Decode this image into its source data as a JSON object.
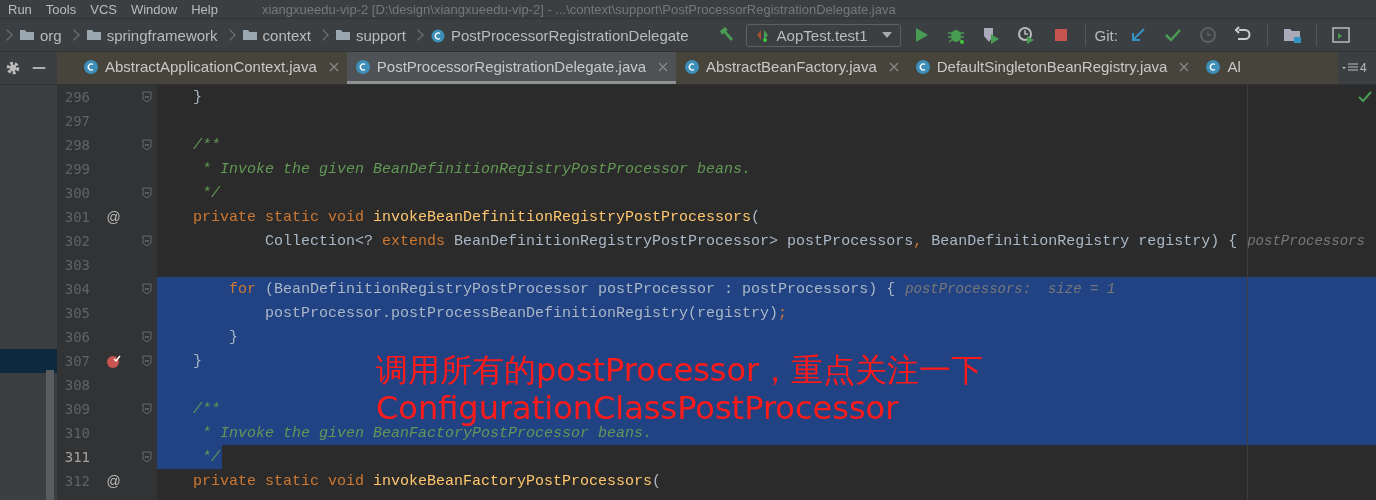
{
  "menu_bar": {
    "items": [
      "Run",
      "Tools",
      "VCS",
      "Window",
      "Help"
    ],
    "title": "xiangxueedu-vip-2 [D:\\design\\xiangxueedu-vip-2] - ...\\context\\support\\PostProcessorRegistrationDelegate.java"
  },
  "breadcrumbs": [
    {
      "kind": "folder",
      "label": "org"
    },
    {
      "kind": "folder",
      "label": "springframework"
    },
    {
      "kind": "folder",
      "label": "context"
    },
    {
      "kind": "folder",
      "label": "support"
    },
    {
      "kind": "class",
      "label": "PostProcessorRegistrationDelegate"
    }
  ],
  "toolbar": {
    "run_config": "AopTest.test1",
    "git_label": "Git:"
  },
  "tabs": [
    {
      "label": "AbstractApplicationContext.java",
      "selected": false,
      "closable": true
    },
    {
      "label": "PostProcessorRegistrationDelegate.java",
      "selected": true,
      "closable": true
    },
    {
      "label": "AbstractBeanFactory.java",
      "selected": false,
      "closable": true
    },
    {
      "label": "DefaultSingletonBeanRegistry.java",
      "selected": false,
      "closable": true
    },
    {
      "label": "Al",
      "selected": false,
      "closable": false
    }
  ],
  "tab_count": "4",
  "lines": [
    {
      "number": "296",
      "fold": true,
      "breakpoint": false,
      "selected": false,
      "current": false,
      "tokens": [
        {
          "kind": "plain",
          "text": "    }"
        }
      ]
    },
    {
      "number": "297",
      "fold": false,
      "breakpoint": false,
      "selected": false,
      "current": false
    },
    {
      "number": "298",
      "fold": true,
      "breakpoint": false,
      "selected": false,
      "current": false,
      "tokens": [
        {
          "kind": "comment",
          "text": "    /**"
        }
      ]
    },
    {
      "number": "299",
      "fold": false,
      "breakpoint": false,
      "selected": false,
      "current": false,
      "tokens": [
        {
          "kind": "comment",
          "text": "     * Invoke the given BeanDefinitionRegistryPostProcessor beans."
        }
      ]
    },
    {
      "number": "300",
      "fold": true,
      "breakpoint": false,
      "selected": false,
      "current": false,
      "tokens": [
        {
          "kind": "comment",
          "text": "     */"
        }
      ]
    },
    {
      "number": "301",
      "gutter_mark": "@",
      "fold": false,
      "breakpoint": false,
      "selected": false,
      "current": false,
      "tokens": [
        {
          "kind": "kw",
          "text": "    private static void "
        },
        {
          "kind": "fn",
          "text": "invokeBeanDefinitionRegistryPostProcessors"
        },
        {
          "kind": "plain",
          "text": "("
        }
      ]
    },
    {
      "number": "302",
      "fold": true,
      "breakpoint": false,
      "selected": false,
      "current": false,
      "tokens": [
        {
          "kind": "plain",
          "text": "            Collection<? "
        },
        {
          "kind": "kw",
          "text": "extends "
        },
        {
          "kind": "plain",
          "text": "BeanDefinitionRegistryPostProcessor> postProcessors"
        },
        {
          "kind": "kw",
          "text": ", "
        },
        {
          "kind": "plain",
          "text": "BeanDefinitionRegistry registry) {"
        }
      ],
      "hint": "postProcessors"
    },
    {
      "number": "303",
      "fold": false,
      "breakpoint": false,
      "selected": false,
      "current": false
    },
    {
      "number": "304",
      "fold": true,
      "breakpoint": false,
      "selected": true,
      "current": false,
      "tokens": [
        {
          "kind": "kw",
          "text": "        for "
        },
        {
          "kind": "plain",
          "text": "(BeanDefinitionRegistryPostProcessor postProcessor : postProcessors) {"
        }
      ],
      "hint": "postProcessors:  size = 1"
    },
    {
      "number": "305",
      "fold": false,
      "breakpoint": false,
      "selected": true,
      "current": false,
      "tokens": [
        {
          "kind": "plain",
          "text": "            postProcessor.postProcessBeanDefinitionRegistry(registry)"
        },
        {
          "kind": "kw",
          "text": ";"
        }
      ]
    },
    {
      "number": "306",
      "fold": true,
      "breakpoint": false,
      "selected": true,
      "current": false,
      "tokens": [
        {
          "kind": "plain",
          "text": "        }"
        }
      ]
    },
    {
      "number": "307",
      "fold": true,
      "breakpoint": true,
      "selected": true,
      "current": false,
      "tokens": [
        {
          "kind": "plain",
          "text": "    }"
        }
      ]
    },
    {
      "number": "308",
      "fold": false,
      "breakpoint": false,
      "selected": true,
      "current": false
    },
    {
      "number": "309",
      "fold": true,
      "breakpoint": false,
      "selected": true,
      "current": false,
      "tokens": [
        {
          "kind": "comment",
          "text": "    /**"
        }
      ]
    },
    {
      "number": "310",
      "fold": false,
      "breakpoint": false,
      "selected": true,
      "current": false,
      "tokens": [
        {
          "kind": "comment",
          "text": "     * Invoke the given BeanFactoryPostProcessor beans."
        }
      ]
    },
    {
      "number": "311",
      "fold": true,
      "breakpoint": false,
      "selected": true,
      "current": true,
      "tokens": [
        {
          "kind": "comment",
          "text": "     */"
        }
      ]
    },
    {
      "number": "312",
      "gutter_mark": "@",
      "fold": false,
      "breakpoint": false,
      "selected": false,
      "current": false,
      "tokens": [
        {
          "kind": "kw",
          "text": "    private static void "
        },
        {
          "kind": "fn",
          "text": "invokeBeanFactoryPostProcessors"
        },
        {
          "kind": "plain",
          "text": "("
        }
      ]
    }
  ],
  "annotation": [
    "调用所有的postProcessor，重点关注一下",
    "ConfigurationClassPostProcessor"
  ]
}
